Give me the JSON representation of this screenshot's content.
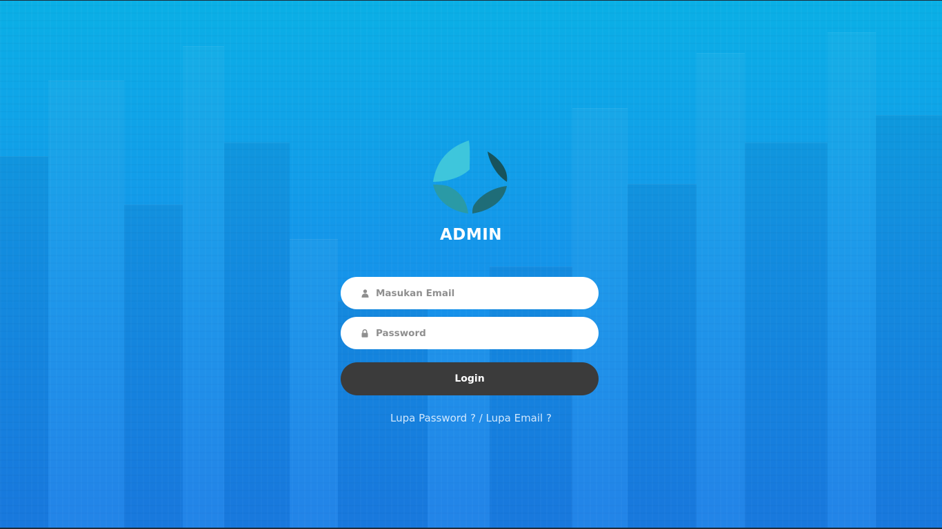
{
  "brand": {
    "title": "ADMIN",
    "logo_icon": "leaf-circle-logo",
    "logo_colors": {
      "light": "#3ec6dc",
      "mid": "#2a9aa6",
      "dark": "#1f6d78",
      "darkest": "#17535c"
    }
  },
  "login_form": {
    "email": {
      "placeholder": "Masukan Email",
      "value": "",
      "icon": "user-icon"
    },
    "password": {
      "placeholder": "Password",
      "value": "",
      "icon": "lock-icon"
    },
    "submit_label": "Login"
  },
  "links": {
    "forgot_password": "Lupa Password ?",
    "separator": " / ",
    "forgot_email": "Lupa Email ?"
  },
  "colors": {
    "background_top": "#0ab0e6",
    "background_bottom": "#1a7fe8",
    "button": "#3b3b3b",
    "input_bg": "#ffffff",
    "input_placeholder": "#8f8f8f"
  }
}
